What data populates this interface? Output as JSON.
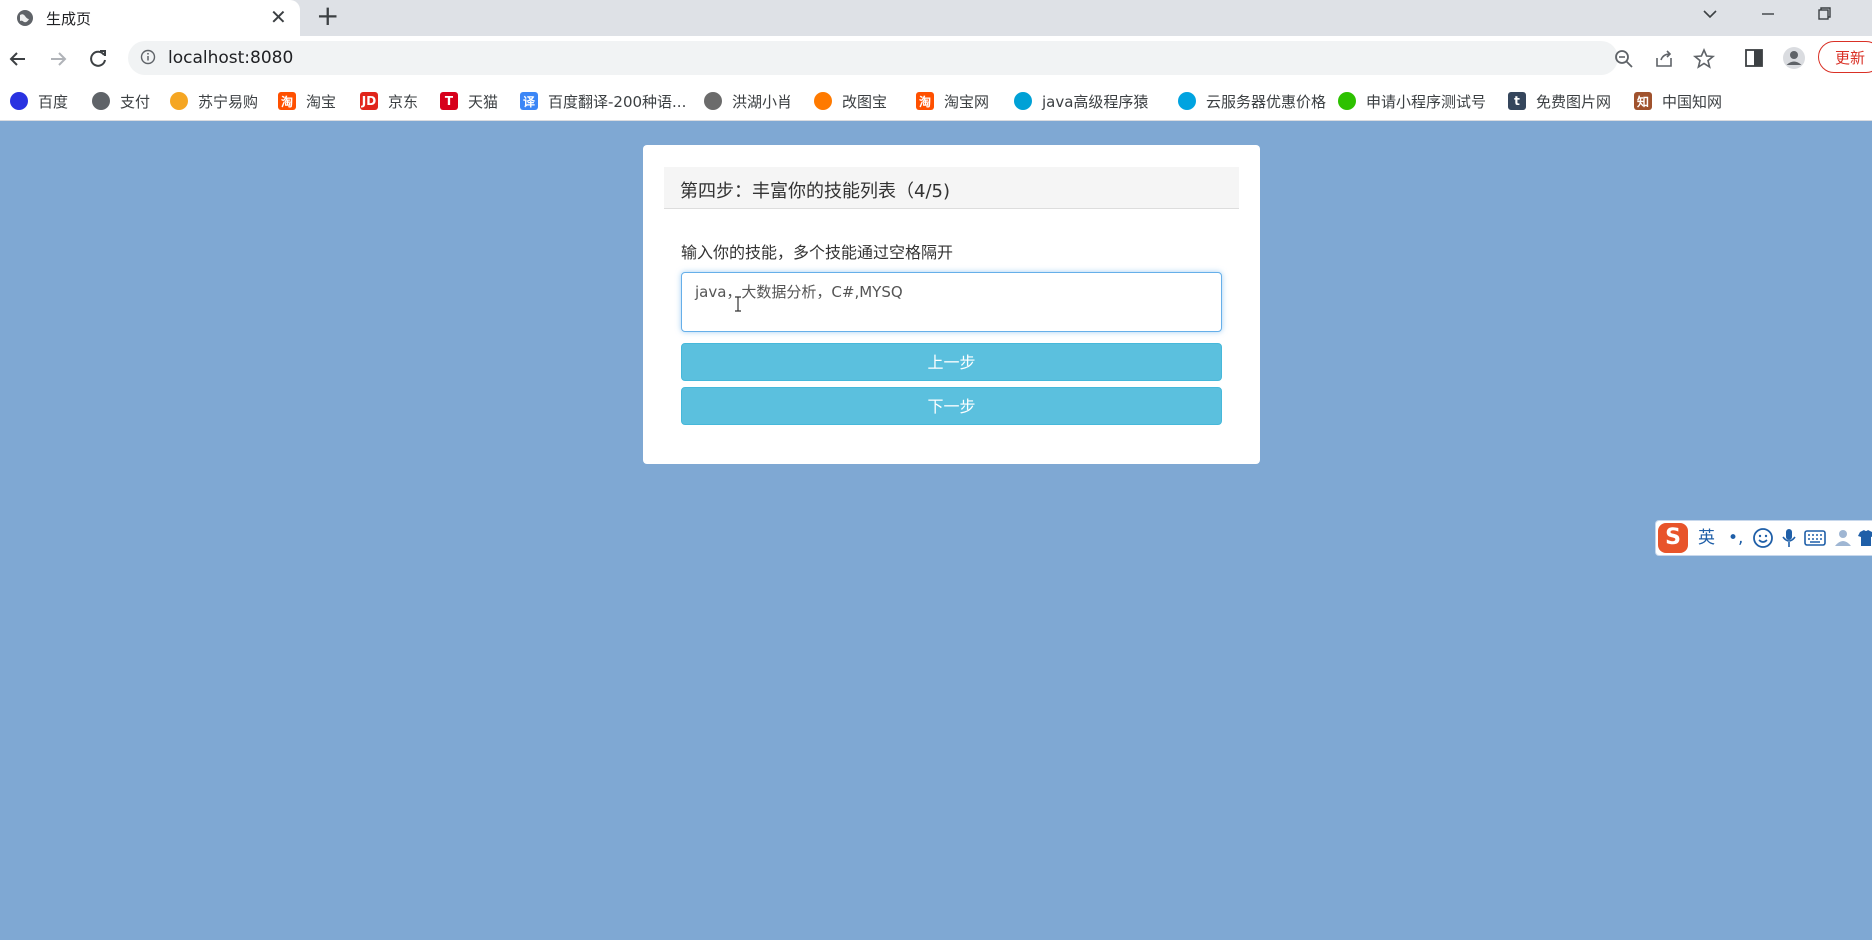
{
  "browser": {
    "tab_title": "生成页",
    "tab_close": "✕",
    "new_tab": "+",
    "url": "localhost:8080",
    "update_label": "更新",
    "bookmarks": [
      {
        "label": "百度",
        "icon": "baidu-paw-icon",
        "color": "#2932e1",
        "glyph": ""
      },
      {
        "label": "支付",
        "icon": "globe-icon",
        "color": "#5f6368",
        "glyph": ""
      },
      {
        "label": "苏宁易购",
        "icon": "suning-lion-icon",
        "color": "#f5a623",
        "glyph": ""
      },
      {
        "label": "淘宝",
        "icon": "taobao-icon",
        "color": "#ff5000",
        "glyph": "淘"
      },
      {
        "label": "京东",
        "icon": "jd-icon",
        "color": "#e1251b",
        "glyph": "JD"
      },
      {
        "label": "天猫",
        "icon": "tmall-icon",
        "color": "#d7001b",
        "glyph": "T"
      },
      {
        "label": "百度翻译-200种语...",
        "icon": "translate-icon",
        "color": "#3b86f6",
        "glyph": "译"
      },
      {
        "label": "洪湖小肖",
        "icon": "bird-icon",
        "color": "#6b6b6b",
        "glyph": ""
      },
      {
        "label": "改图宝",
        "icon": "gaitubao-icon",
        "color": "#ff7a00",
        "glyph": ""
      },
      {
        "label": "淘宝网",
        "icon": "taobao-icon",
        "color": "#ff5000",
        "glyph": "淘"
      },
      {
        "label": "java高级程序猿",
        "icon": "bilibili-icon",
        "color": "#00a1d6",
        "glyph": ""
      },
      {
        "label": "云服务器优惠价格",
        "icon": "cloud-icon",
        "color": "#00a3e0",
        "glyph": ""
      },
      {
        "label": "申请小程序测试号",
        "icon": "wechat-icon",
        "color": "#2dc100",
        "glyph": ""
      },
      {
        "label": "免费图片网",
        "icon": "tumblr-icon",
        "color": "#35465c",
        "glyph": "t"
      },
      {
        "label": "中国知网",
        "icon": "cnki-icon",
        "color": "#a0522d",
        "glyph": "知"
      }
    ]
  },
  "page": {
    "header_title": "第四步：丰富你的技能列表（4/5)",
    "field_label": "输入你的技能，多个技能通过空格隔开",
    "skills_value": "java，大数据分析，C#,MYSQ",
    "prev_label": "上一步",
    "next_label": "下一步"
  },
  "ime": {
    "mode": "英",
    "punct": "•,"
  },
  "colors": {
    "page_bg": "#7fa8d3",
    "button_bg": "#5bc0de",
    "update_red": "#d93025"
  }
}
